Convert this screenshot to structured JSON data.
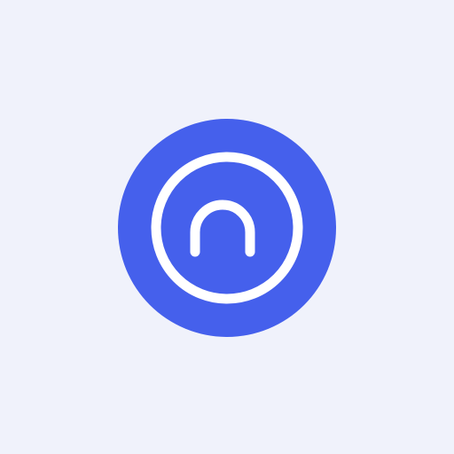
{
  "logo": {
    "icon": "n-monogram-logo-icon",
    "background_color": "#4560ec",
    "foreground_color": "#ffffff",
    "page_background_color": "#f0f2fb"
  }
}
